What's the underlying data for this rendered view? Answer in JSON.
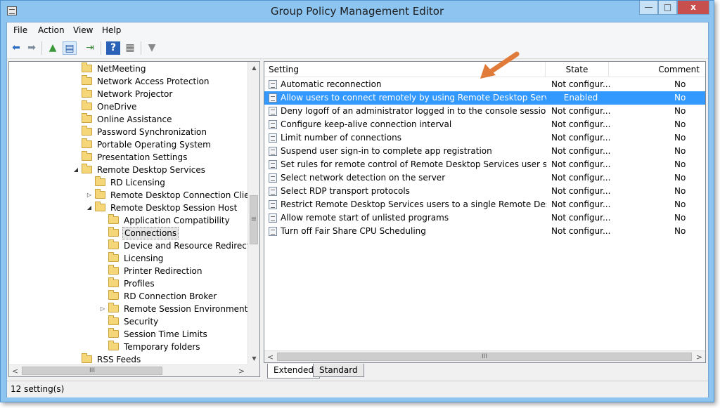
{
  "window": {
    "title": "Group Policy Management Editor",
    "min_glyph": "—",
    "max_glyph": "□",
    "close_glyph": "x"
  },
  "menu": [
    "File",
    "Action",
    "View",
    "Help"
  ],
  "toolbar": {
    "back_glyph": "⬅",
    "forward_glyph": "➡",
    "up_glyph": "▲",
    "showhide_glyph": "▤",
    "export_glyph": "⇥",
    "help_glyph": "?",
    "properties_glyph": "▦",
    "filter_glyph": "▼"
  },
  "tree": {
    "items": [
      {
        "label": "NetMeeting",
        "expander": ""
      },
      {
        "label": "Network Access Protection",
        "expander": ""
      },
      {
        "label": "Network Projector",
        "expander": ""
      },
      {
        "label": "OneDrive",
        "expander": ""
      },
      {
        "label": "Online Assistance",
        "expander": ""
      },
      {
        "label": "Password Synchronization",
        "expander": ""
      },
      {
        "label": "Portable Operating System",
        "expander": ""
      },
      {
        "label": "Presentation Settings",
        "expander": ""
      },
      {
        "label": "Remote Desktop Services",
        "expander": "◢"
      },
      {
        "label": "RD Licensing",
        "expander": ""
      },
      {
        "label": "Remote Desktop Connection Client",
        "expander": "▷"
      },
      {
        "label": "Remote Desktop Session Host",
        "expander": "◢"
      },
      {
        "label": "Application Compatibility",
        "expander": ""
      },
      {
        "label": "Connections",
        "expander": ""
      },
      {
        "label": "Device and Resource Redirection",
        "expander": ""
      },
      {
        "label": "Licensing",
        "expander": ""
      },
      {
        "label": "Printer Redirection",
        "expander": ""
      },
      {
        "label": "Profiles",
        "expander": ""
      },
      {
        "label": "RD Connection Broker",
        "expander": ""
      },
      {
        "label": "Remote Session Environment",
        "expander": "▷"
      },
      {
        "label": "Security",
        "expander": ""
      },
      {
        "label": "Session Time Limits",
        "expander": ""
      },
      {
        "label": "Temporary folders",
        "expander": ""
      },
      {
        "label": "RSS Feeds",
        "expander": ""
      }
    ],
    "selected": "Connections"
  },
  "list": {
    "columns": {
      "setting": "Setting",
      "state": "State",
      "comment": "Comment"
    },
    "rows": [
      {
        "setting": "Automatic reconnection",
        "state": "Not configur...",
        "comment": "No"
      },
      {
        "setting": "Allow users to connect remotely by using Remote Desktop Services",
        "state": "Enabled",
        "comment": "No"
      },
      {
        "setting": "Deny logoff of an administrator logged in to the console session",
        "state": "Not configur...",
        "comment": "No"
      },
      {
        "setting": "Configure keep-alive connection interval",
        "state": "Not configur...",
        "comment": "No"
      },
      {
        "setting": "Limit number of connections",
        "state": "Not configur...",
        "comment": "No"
      },
      {
        "setting": "Suspend user sign-in to complete app registration",
        "state": "Not configur...",
        "comment": "No"
      },
      {
        "setting": "Set rules for remote control of Remote Desktop Services user sessions",
        "state": "Not configur...",
        "comment": "No"
      },
      {
        "setting": "Select network detection on the server",
        "state": "Not configur...",
        "comment": "No"
      },
      {
        "setting": "Select RDP transport protocols",
        "state": "Not configur...",
        "comment": "No"
      },
      {
        "setting": "Restrict Remote Desktop Services users to a single Remote Desktop Se...",
        "state": "Not configur...",
        "comment": "No"
      },
      {
        "setting": "Allow remote start of unlisted programs",
        "state": "Not configur...",
        "comment": "No"
      },
      {
        "setting": "Turn off Fair Share CPU Scheduling",
        "state": "Not configur...",
        "comment": "No"
      }
    ],
    "selected_index": 1
  },
  "scroll": {
    "up": "▲",
    "down": "▼",
    "left": "<",
    "right": ">",
    "grip_v": "≡",
    "grip_h": "III"
  },
  "tabs": [
    "Extended",
    "Standard"
  ],
  "status": "12 setting(s)",
  "annotation_color": "#e07b39"
}
